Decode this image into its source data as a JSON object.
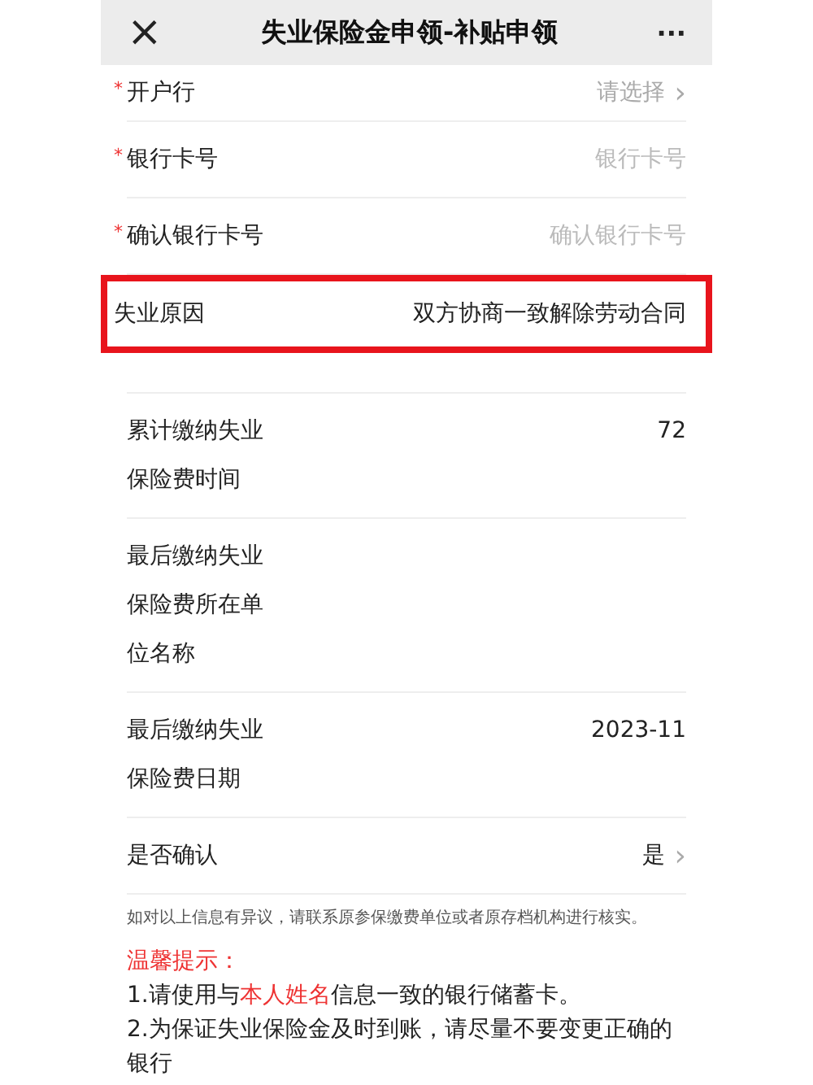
{
  "nav_bar": {
    "title": "失业保险金申领-补贴申领",
    "close": "×",
    "more": "···"
  },
  "form_rows": [
    {
      "kind": "select",
      "label": "开户行",
      "required_mark": "*",
      "placeholder": "请选择",
      "chevron": "›",
      "highlighted": false
    },
    {
      "kind": "input",
      "label": "银行卡号",
      "required_mark": "*",
      "placeholder": "银行卡号",
      "highlighted": false
    },
    {
      "kind": "input",
      "label": "确认银行卡号",
      "required_mark": "*",
      "placeholder": "确认银行卡号",
      "highlighted": false
    },
    {
      "kind": "value",
      "label": "失业原因",
      "value": "双方协商一致解除劳动合同",
      "highlighted": true
    }
  ],
  "info_rows": [
    {
      "kind": "value",
      "label": "累计缴纳失业保险费时间",
      "value": "72"
    },
    {
      "kind": "value",
      "label": "最后缴纳失业保险费所在单位名称"
    },
    {
      "kind": "value",
      "label": "最后缴纳失业保险费日期",
      "value": "2023-11"
    },
    {
      "kind": "select",
      "label": "是否确认",
      "value": "是",
      "chevron": "›"
    }
  ],
  "note": "如对以上信息有异议，请联系原参保缴费单位或者原存档机构进行核实。",
  "tips": {
    "title": "温馨提示：",
    "items": [
      "1.请使用与**本人姓名**信息一致的银行储蓄卡。",
      "2.为保证失业保险金及时到账，请尽量不要变更正确的银行"
    ]
  }
}
